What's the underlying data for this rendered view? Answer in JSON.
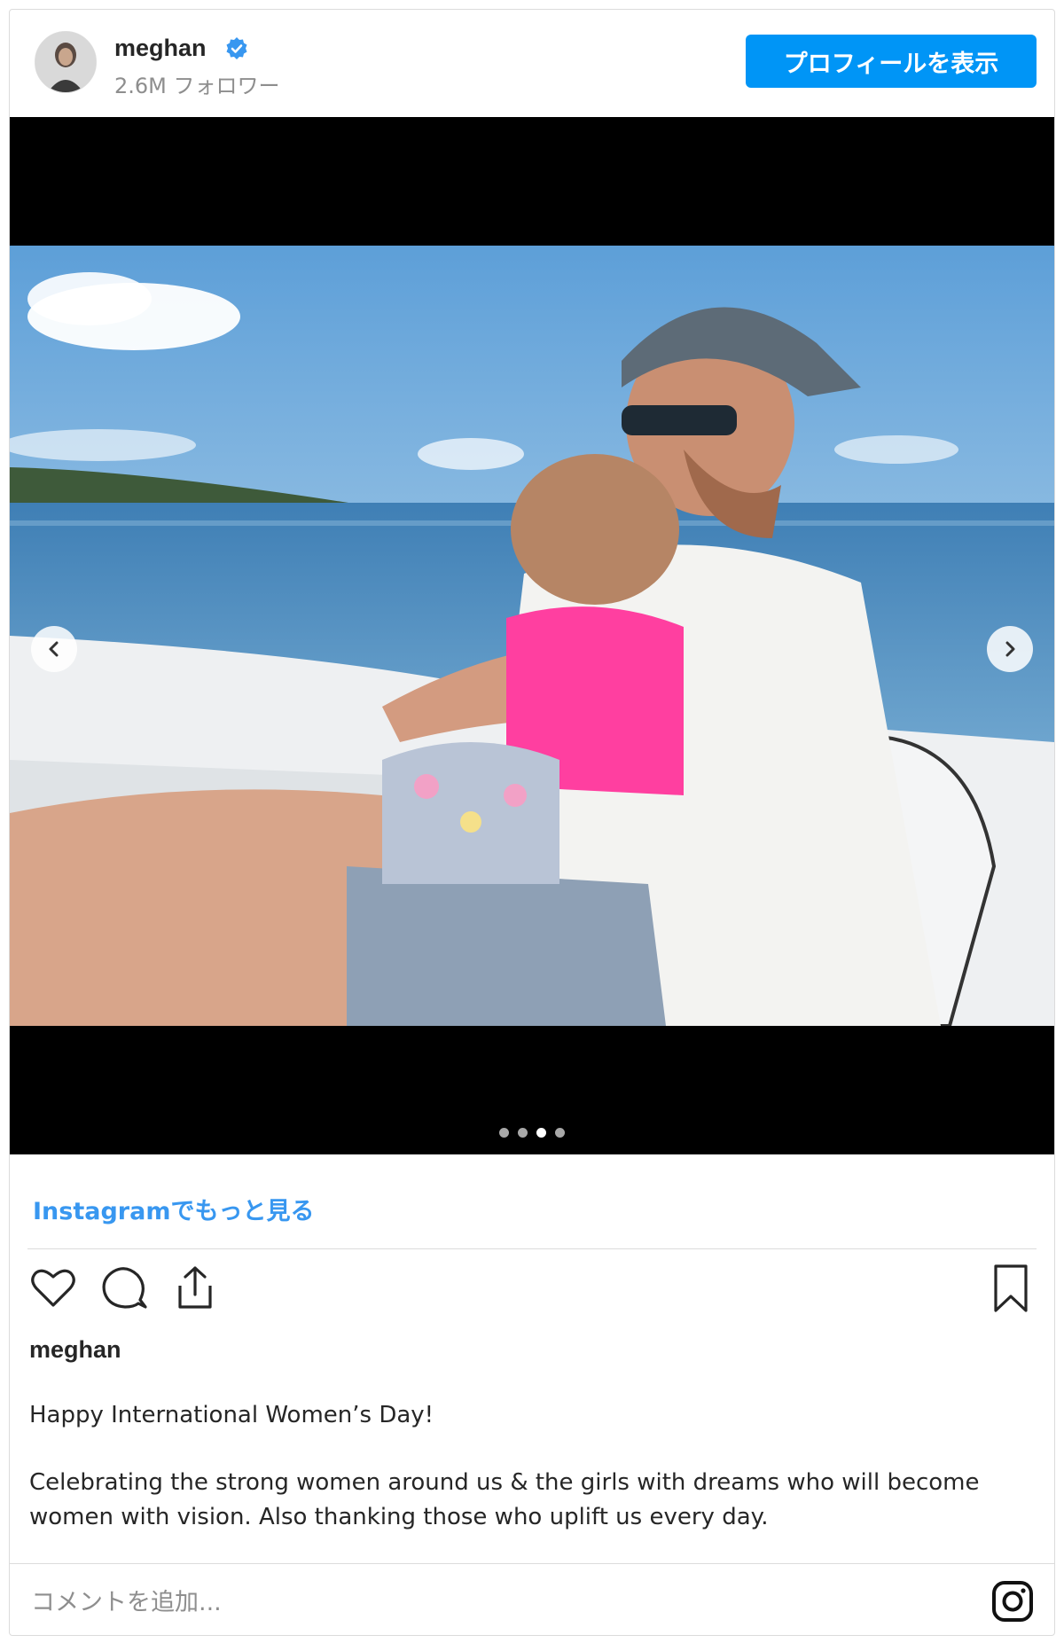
{
  "header": {
    "username": "meghan",
    "followers": "2.6M フォロワー",
    "profile_button": "プロフィールを表示"
  },
  "icons": {
    "verified": "verified-badge-icon",
    "prev": "chevron-left-icon",
    "next": "chevron-right-icon",
    "like": "heart-icon",
    "comment": "comment-icon",
    "share": "share-icon",
    "save": "bookmark-icon",
    "logo": "instagram-logo-icon"
  },
  "carousel": {
    "total": 4,
    "active_index": 2
  },
  "more_link": "Instagramでもっと見る",
  "caption": {
    "username": "meghan",
    "line1": "Happy International Women’s Day!",
    "line2": "Celebrating the strong women around us & the girls with dreams who will become",
    "line3": "women with vision. Also thanking those who uplift us every day."
  },
  "comment": {
    "placeholder": "コメントを追加..."
  },
  "colors": {
    "accent": "#0095f6",
    "link": "#3897f0",
    "text": "#262626",
    "muted": "#8e8e8e"
  }
}
